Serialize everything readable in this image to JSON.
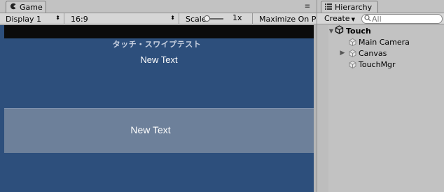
{
  "game": {
    "tab_label": "Game",
    "tab_icon": "pacman-game-icon",
    "display": "Display 1",
    "aspect": "16:9",
    "scale_label": "Scale",
    "scale_value": "1x",
    "maximize": "Maximize On Pl",
    "view": {
      "title_text": "タッチ・スワイプテスト",
      "text_1": "New Text",
      "text_2": "New Text"
    }
  },
  "hierarchy": {
    "tab_label": "Hierarchy",
    "create_label": "Create",
    "search_placeholder": "All",
    "scene": "Touch",
    "items": [
      "Main Camera",
      "Canvas",
      "TouchMgr"
    ]
  },
  "colors": {
    "game_background": "#2d4f7c",
    "swipe_band": "#6d809a",
    "panel_bg": "#c2c2c2"
  }
}
